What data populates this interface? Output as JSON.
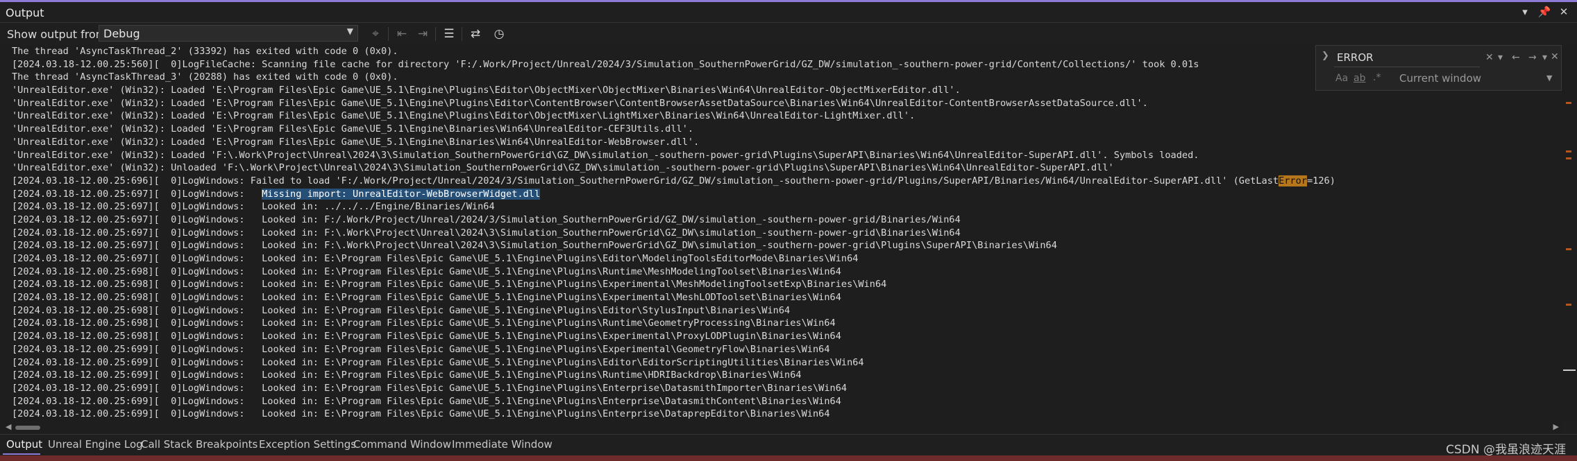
{
  "window": {
    "title": "Output"
  },
  "toolbar": {
    "show_label": "Show output from:",
    "source": "Debug"
  },
  "find": {
    "query": "ERROR",
    "scope": "Current window",
    "case_label": "Aa",
    "word_label": "ab"
  },
  "output_lines": [
    "The thread 'AsyncTaskThread_2' (33392) has exited with code 0 (0x0).",
    "[2024.03.18-12.00.25:560][  0]LogFileCache: Scanning file cache for directory 'F:/.Work/Project/Unreal/2024/3/Simulation_SouthernPowerGrid/GZ_DW/simulation_-southern-power-grid/Content/Collections/' took 0.01s",
    "The thread 'AsyncTaskThread_3' (20288) has exited with code 0 (0x0).",
    "'UnrealEditor.exe' (Win32): Loaded 'E:\\Program Files\\Epic Game\\UE_5.1\\Engine\\Plugins\\Editor\\ObjectMixer\\ObjectMixer\\Binaries\\Win64\\UnrealEditor-ObjectMixerEditor.dll'.",
    "'UnrealEditor.exe' (Win32): Loaded 'E:\\Program Files\\Epic Game\\UE_5.1\\Engine\\Plugins\\Editor\\ContentBrowser\\ContentBrowserAssetDataSource\\Binaries\\Win64\\UnrealEditor-ContentBrowserAssetDataSource.dll'.",
    "'UnrealEditor.exe' (Win32): Loaded 'E:\\Program Files\\Epic Game\\UE_5.1\\Engine\\Plugins\\Editor\\ObjectMixer\\LightMixer\\Binaries\\Win64\\UnrealEditor-LightMixer.dll'.",
    "'UnrealEditor.exe' (Win32): Loaded 'E:\\Program Files\\Epic Game\\UE_5.1\\Engine\\Binaries\\Win64\\UnrealEditor-CEF3Utils.dll'.",
    "'UnrealEditor.exe' (Win32): Loaded 'E:\\Program Files\\Epic Game\\UE_5.1\\Engine\\Binaries\\Win64\\UnrealEditor-WebBrowser.dll'.",
    "'UnrealEditor.exe' (Win32): Loaded 'F:\\.Work\\Project\\Unreal\\2024\\3\\Simulation_SouthernPowerGrid\\GZ_DW\\simulation_-southern-power-grid\\Plugins\\SuperAPI\\Binaries\\Win64\\UnrealEditor-SuperAPI.dll'. Symbols loaded.",
    "'UnrealEditor.exe' (Win32): Unloaded 'F:\\.Work\\Project\\Unreal\\2024\\3\\Simulation_SouthernPowerGrid\\GZ_DW\\simulation_-southern-power-grid\\Plugins\\SuperAPI\\Binaries\\Win64\\UnrealEditor-SuperAPI.dll'",
    "[2024.03.18-12.00.25:696][  0]LogWindows: Failed to load 'F:/.Work/Project/Unreal/2024/3/Simulation_SouthernPowerGrid/GZ_DW/simulation_-southern-power-grid/Plugins/SuperAPI/Binaries/Win64/UnrealEditor-SuperAPI.dll' (GetLastError=126)",
    "[2024.03.18-12.00.25:697][  0]LogWindows:   Missing import: UnrealEditor-WebBrowserWidget.dll",
    "[2024.03.18-12.00.25:697][  0]LogWindows:   Looked in: ../../../Engine/Binaries/Win64",
    "[2024.03.18-12.00.25:697][  0]LogWindows:   Looked in: F:/.Work/Project/Unreal/2024/3/Simulation_SouthernPowerGrid/GZ_DW/simulation_-southern-power-grid/Binaries/Win64",
    "[2024.03.18-12.00.25:697][  0]LogWindows:   Looked in: F:\\.Work\\Project\\Unreal\\2024\\3\\Simulation_SouthernPowerGrid\\GZ_DW\\simulation_-southern-power-grid\\Binaries\\Win64",
    "[2024.03.18-12.00.25:697][  0]LogWindows:   Looked in: F:\\.Work\\Project\\Unreal\\2024\\3\\Simulation_SouthernPowerGrid\\GZ_DW\\simulation_-southern-power-grid\\Plugins\\SuperAPI\\Binaries\\Win64",
    "[2024.03.18-12.00.25:697][  0]LogWindows:   Looked in: E:\\Program Files\\Epic Game\\UE_5.1\\Engine\\Plugins\\Editor\\ModelingToolsEditorMode\\Binaries\\Win64",
    "[2024.03.18-12.00.25:698][  0]LogWindows:   Looked in: E:\\Program Files\\Epic Game\\UE_5.1\\Engine\\Plugins\\Runtime\\MeshModelingToolset\\Binaries\\Win64",
    "[2024.03.18-12.00.25:698][  0]LogWindows:   Looked in: E:\\Program Files\\Epic Game\\UE_5.1\\Engine\\Plugins\\Experimental\\MeshModelingToolsetExp\\Binaries\\Win64",
    "[2024.03.18-12.00.25:698][  0]LogWindows:   Looked in: E:\\Program Files\\Epic Game\\UE_5.1\\Engine\\Plugins\\Experimental\\MeshLODToolset\\Binaries\\Win64",
    "[2024.03.18-12.00.25:698][  0]LogWindows:   Looked in: E:\\Program Files\\Epic Game\\UE_5.1\\Engine\\Plugins\\Editor\\StylusInput\\Binaries\\Win64",
    "[2024.03.18-12.00.25:698][  0]LogWindows:   Looked in: E:\\Program Files\\Epic Game\\UE_5.1\\Engine\\Plugins\\Runtime\\GeometryProcessing\\Binaries\\Win64",
    "[2024.03.18-12.00.25:698][  0]LogWindows:   Looked in: E:\\Program Files\\Epic Game\\UE_5.1\\Engine\\Plugins\\Experimental\\ProxyLODPlugin\\Binaries\\Win64",
    "[2024.03.18-12.00.25:699][  0]LogWindows:   Looked in: E:\\Program Files\\Epic Game\\UE_5.1\\Engine\\Plugins\\Experimental\\GeometryFlow\\Binaries\\Win64",
    "[2024.03.18-12.00.25:699][  0]LogWindows:   Looked in: E:\\Program Files\\Epic Game\\UE_5.1\\Engine\\Plugins\\Editor\\EditorScriptingUtilities\\Binaries\\Win64",
    "[2024.03.18-12.00.25:699][  0]LogWindows:   Looked in: E:\\Program Files\\Epic Game\\UE_5.1\\Engine\\Plugins\\Runtime\\HDRIBackdrop\\Binaries\\Win64",
    "[2024.03.18-12.00.25:699][  0]LogWindows:   Looked in: E:\\Program Files\\Epic Game\\UE_5.1\\Engine\\Plugins\\Enterprise\\DatasmithImporter\\Binaries\\Win64",
    "[2024.03.18-12.00.25:699][  0]LogWindows:   Looked in: E:\\Program Files\\Epic Game\\UE_5.1\\Engine\\Plugins\\Enterprise\\DatasmithContent\\Binaries\\Win64",
    "[2024.03.18-12.00.25:699][  0]LogWindows:   Looked in: E:\\Program Files\\Epic Game\\UE_5.1\\Engine\\Plugins\\Enterprise\\DataprepEditor\\Binaries\\Win64"
  ],
  "selection": {
    "line": 11,
    "text": "Missing import: UnrealEditor-WebBrowserWidget.dll"
  },
  "highlight": {
    "line": 10,
    "text": "Error"
  },
  "tabs": [
    {
      "label": "Output"
    },
    {
      "label": "Unreal Engine Log"
    },
    {
      "label": "Call Stack"
    },
    {
      "label": "Breakpoints"
    },
    {
      "label": "Exception Settings"
    },
    {
      "label": "Command Window"
    },
    {
      "label": "Immediate Window"
    }
  ],
  "watermark": "CSDN @我虽浪迹天涯",
  "colors": {
    "accent": "#8c7ad6",
    "selection": "#264f78",
    "find_highlight": "#b5761c",
    "scroll_marker": "#b5561c"
  }
}
